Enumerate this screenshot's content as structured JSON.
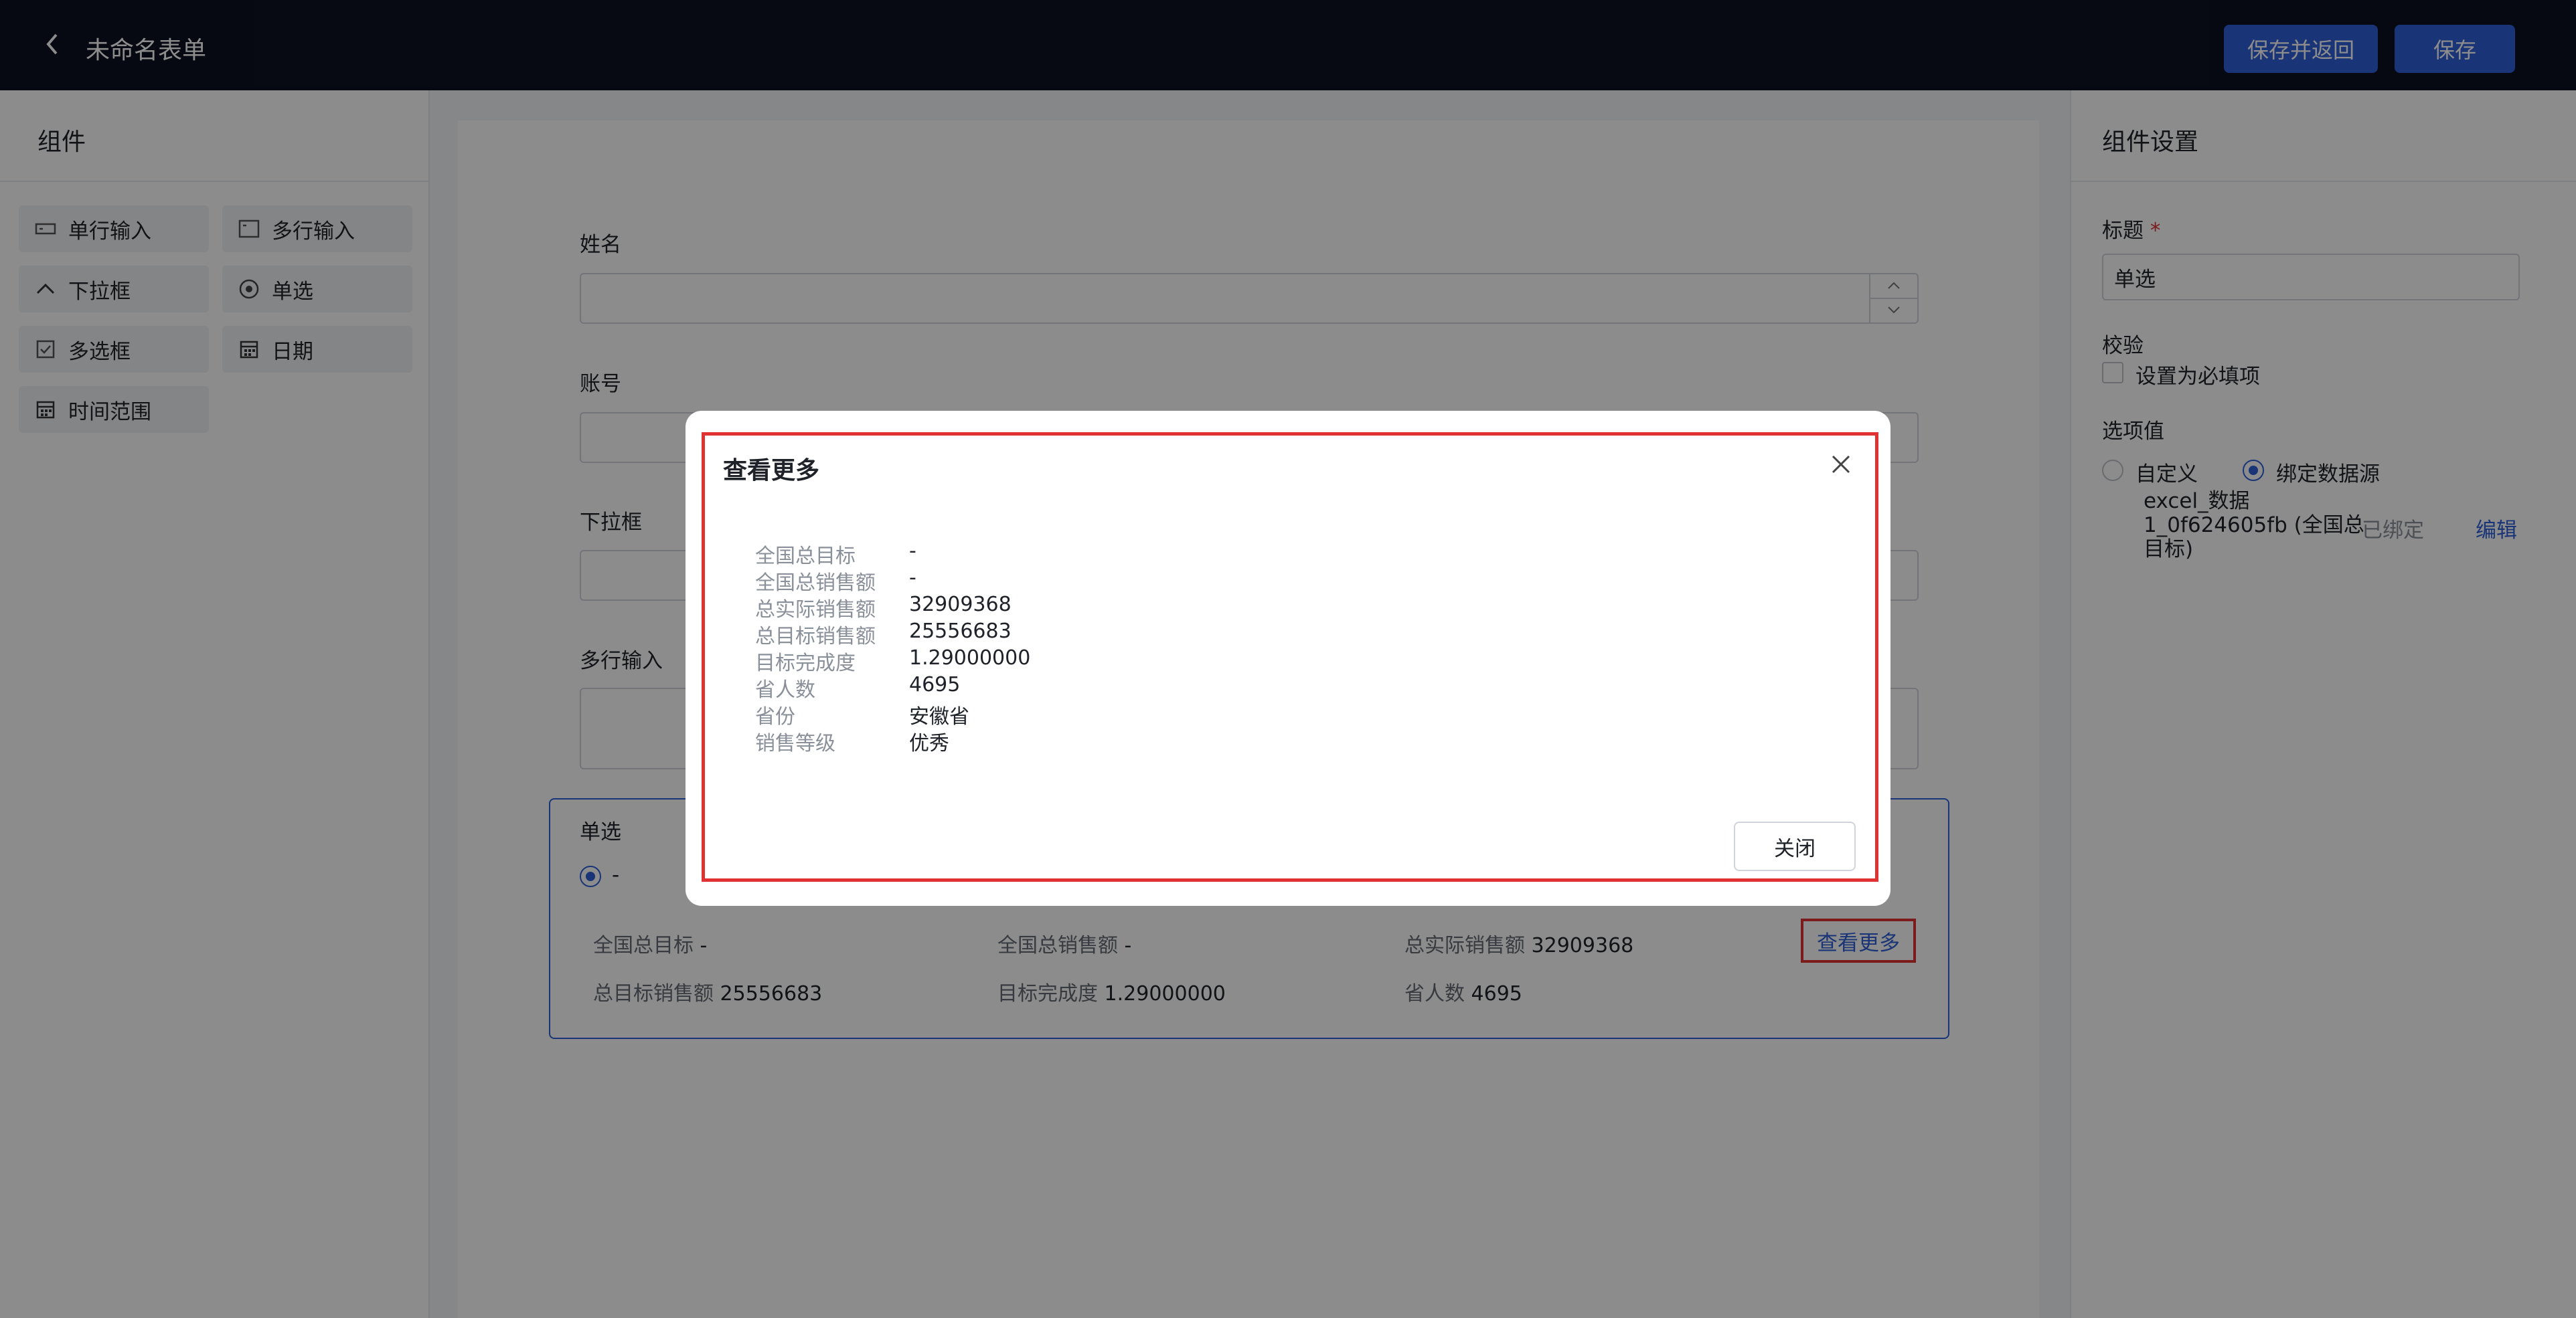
{
  "header": {
    "title": "未命名表单",
    "save_return_label": "保存并返回",
    "save_label": "保存"
  },
  "left_panel": {
    "title": "组件",
    "components": [
      {
        "label": "单行输入",
        "icon": "single-line-input-icon"
      },
      {
        "label": "多行输入",
        "icon": "multi-line-input-icon"
      },
      {
        "label": "下拉框",
        "icon": "chevron-up-icon"
      },
      {
        "label": "单选",
        "icon": "radio-icon"
      },
      {
        "label": "多选框",
        "icon": "checkbox-icon"
      },
      {
        "label": "日期",
        "icon": "calendar-icon"
      },
      {
        "label": "时间范围",
        "icon": "calendar-range-icon"
      }
    ]
  },
  "form": {
    "fields": [
      {
        "label": "姓名"
      },
      {
        "label": "账号"
      },
      {
        "label": "下拉框"
      },
      {
        "label": "多行输入"
      }
    ],
    "radio": {
      "label": "单选",
      "option": "-",
      "summary": [
        {
          "key": "全国总目标",
          "value": "-"
        },
        {
          "key": "全国总销售额",
          "value": "-"
        },
        {
          "key": "总实际销售额",
          "value": "32909368"
        },
        {
          "key": "总目标销售额",
          "value": "25556683"
        },
        {
          "key": "目标完成度",
          "value": "1.29000000"
        },
        {
          "key": "省人数",
          "value": "4695"
        }
      ],
      "view_more": "查看更多"
    }
  },
  "right_panel": {
    "title": "组件设置",
    "title_label": "标题",
    "required_mark": "*",
    "title_value": "单选",
    "validation_label": "校验",
    "required_checkbox_label": "设置为必填项",
    "options_label": "选项值",
    "custom_label": "自定义",
    "bind_label": "绑定数据源",
    "data_source_lines": [
      "excel_数据",
      "1_0f624605fb (全国总",
      "目标)"
    ],
    "bound_status": "已绑定",
    "edit_label": "编辑"
  },
  "modal": {
    "title": "查看更多",
    "rows": [
      {
        "key": "全国总目标",
        "value": "-"
      },
      {
        "key": "全国总销售额",
        "value": "-"
      },
      {
        "key": "总实际销售额",
        "value": "32909368"
      },
      {
        "key": "总目标销售额",
        "value": "25556683"
      },
      {
        "key": "目标完成度",
        "value": "1.29000000"
      },
      {
        "key": "省人数",
        "value": "4695"
      },
      {
        "key": "省份",
        "value": "安徽省"
      },
      {
        "key": "销售等级",
        "value": "优秀"
      }
    ],
    "close_label": "关闭"
  },
  "colors": {
    "topbar": "#0c1220",
    "primary": "#2f5fd9",
    "highlight": "#e03232"
  }
}
